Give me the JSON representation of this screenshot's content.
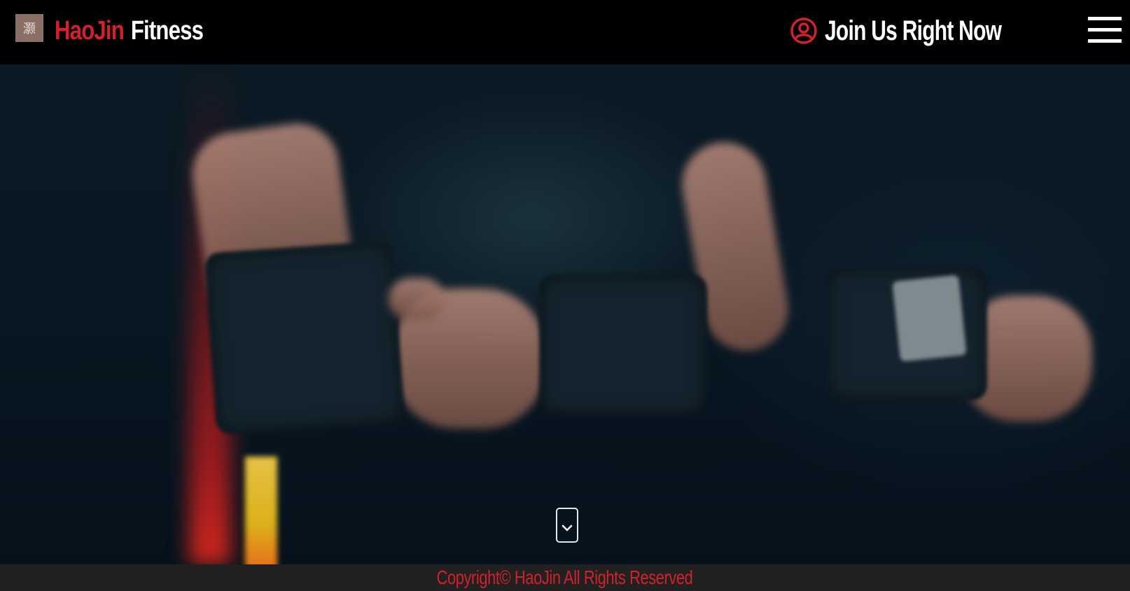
{
  "header": {
    "logo_glyph": "灏",
    "brand": {
      "accent_text": "HaoJin",
      "plain_text": "Fitness"
    },
    "join_label": "Join Us Right Now",
    "user_icon": "user-circle-icon",
    "menu_icon": "hamburger-menu-icon"
  },
  "hero": {
    "scroll_icon": "chevron-down-icon"
  },
  "footer": {
    "copyright": "Copyright© HaoJin All Rights Reserved"
  },
  "colors": {
    "accent": "#d3202d",
    "header_bg": "#000000",
    "footer_bg": "#212121",
    "text_light": "#ffffff"
  }
}
